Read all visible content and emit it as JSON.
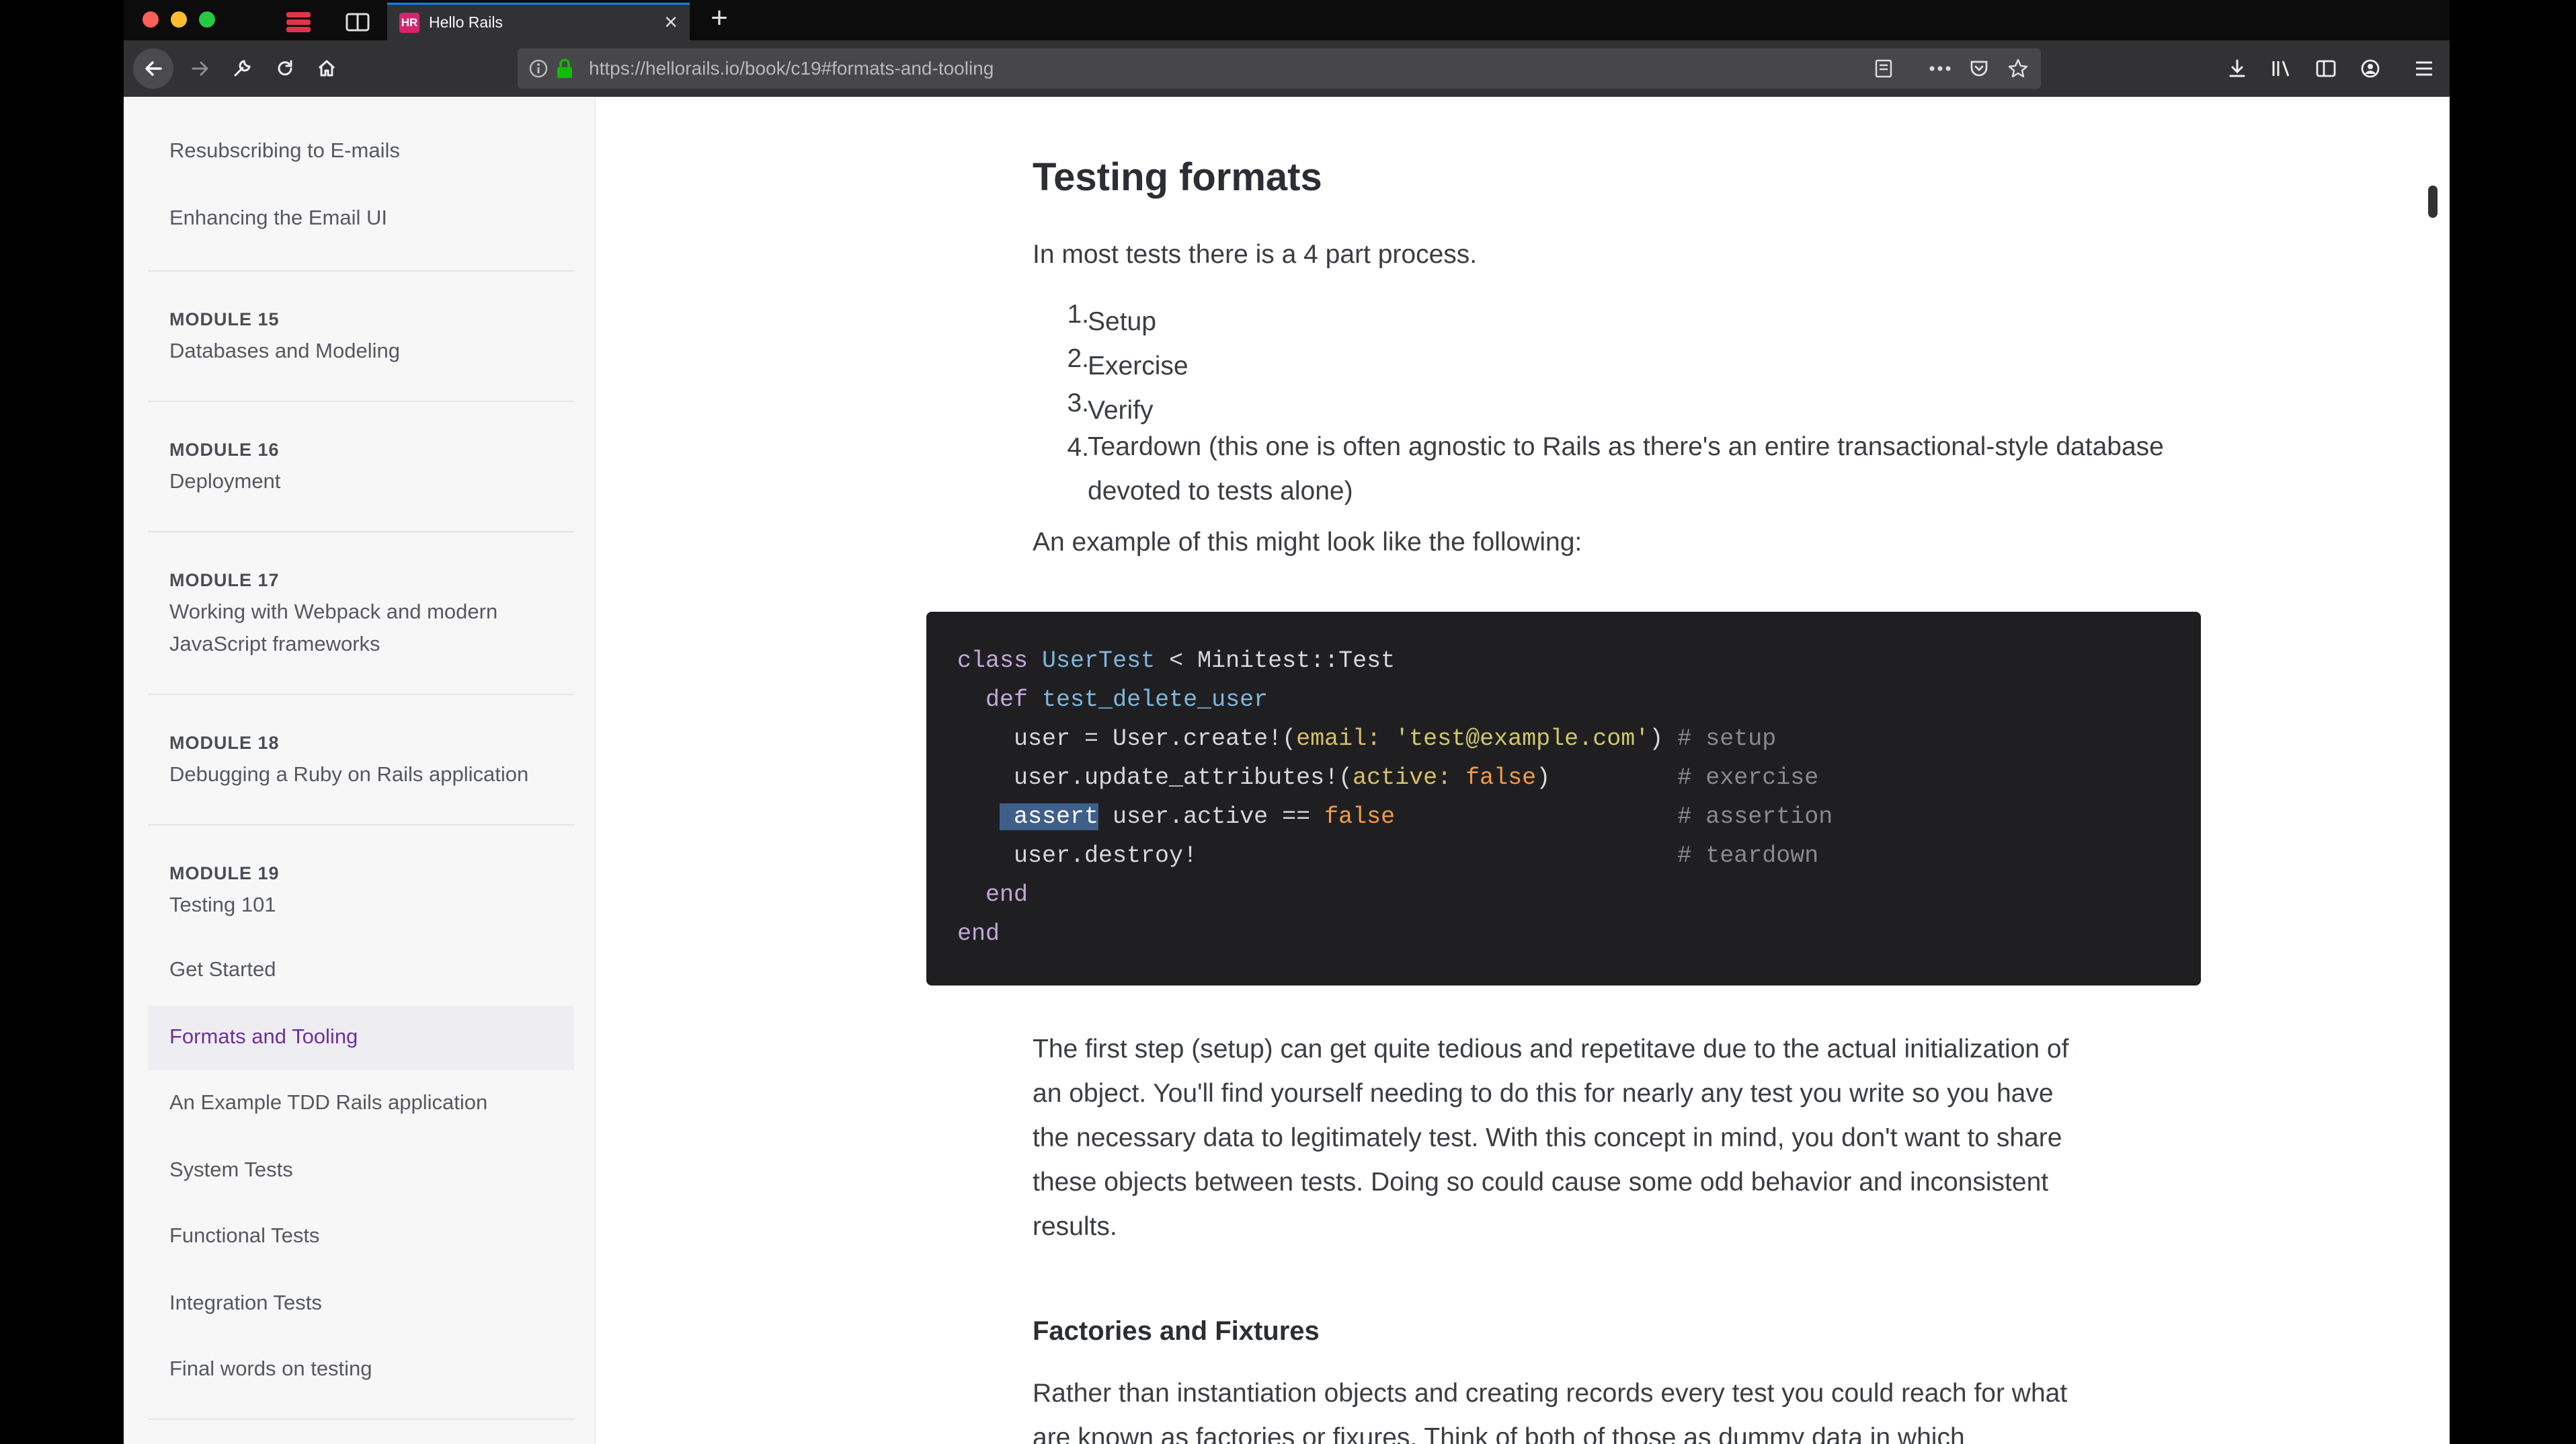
{
  "browser": {
    "tab_title": "Hello Rails",
    "tab_favicon": "HR",
    "url_host": "https://hellorails.io",
    "url_path": "/book/c19#formats-and-tooling"
  },
  "sidebar": {
    "items_top": [
      "Resubscribing to E-mails",
      "Enhancing the Email UI"
    ],
    "modules": [
      {
        "label": "MODULE 15",
        "title": "Databases and Modeling"
      },
      {
        "label": "MODULE 16",
        "title": "Deployment"
      },
      {
        "label": "MODULE 17",
        "title": "Working with Webpack and modern JavaScript frameworks"
      },
      {
        "label": "MODULE 18",
        "title": "Debugging a Ruby on Rails application"
      },
      {
        "label": "MODULE 19",
        "title": "Testing 101"
      }
    ],
    "chapters": [
      "Get Started",
      "Formats and Tooling",
      "An Example TDD Rails application",
      "System Tests",
      "Functional Tests",
      "Integration Tests",
      "Final words on testing"
    ],
    "active_color": "#6f2f9f"
  },
  "content": {
    "heading": "Testing formats",
    "intro": "In most tests there is a 4 part process.",
    "steps": [
      {
        "num": "1.",
        "text": "Setup"
      },
      {
        "num": "2.",
        "text": "Exercise"
      },
      {
        "num": "3.",
        "text": "Verify"
      },
      {
        "num": "4.",
        "text": "Teardown (this one is often agnostic to Rails as there's an entire transactional-style database devoted to tests alone)"
      }
    ],
    "example_intro": "An example of this might look like the following:",
    "code_lines": [
      "class UserTest < Minitest::Test",
      "  def test_delete_user",
      "    user = User.create!(email: 'test@example.com') # setup",
      "    user.update_attributes!(active: false)         # exercise",
      "    assert user.active == false                    # assertion",
      "    user.destroy!                                  # teardown",
      "  end",
      "end"
    ],
    "paragraph1": "The first step (setup) can get quite tedious and repetitave due to the actual initialization of an object. You'll find yourself needing to do this for nearly any test you write so you have the necessary data to legitimately test. With this concept in mind, you don't want to share these objects between tests. Doing so could cause some odd behavior and inconsistent results.",
    "subheading": "Factories and Fixtures",
    "paragraph2": "Rather than instantiation objects and creating records every test you could reach for what are known as factories or fixures. Think of both of those as dummy data in which"
  }
}
